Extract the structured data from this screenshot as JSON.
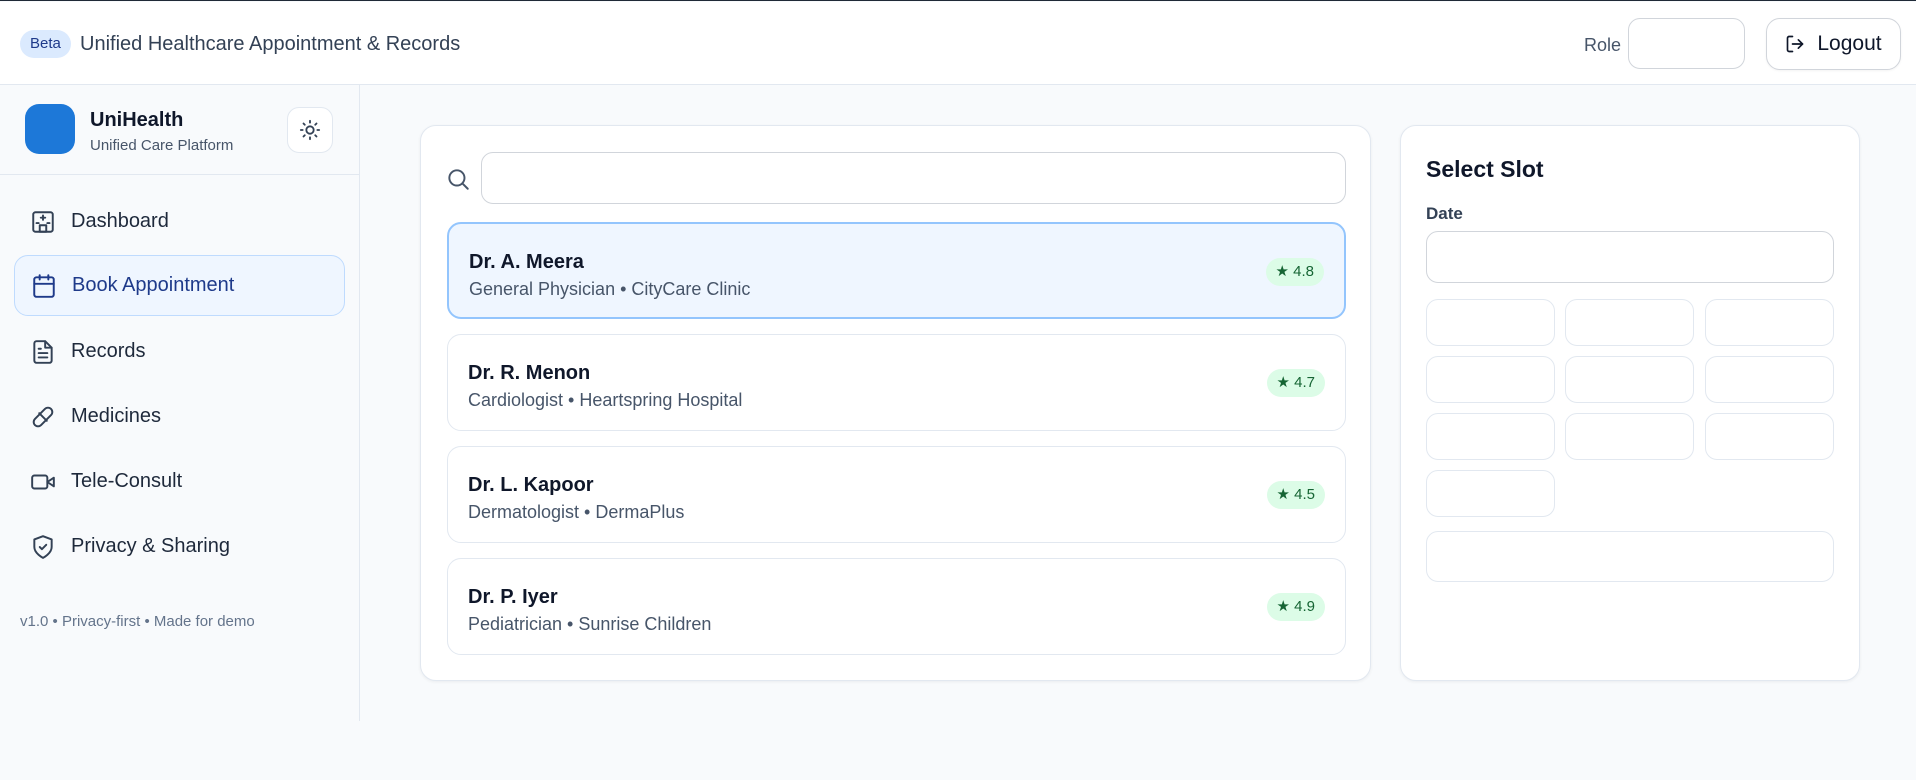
{
  "header": {
    "badge": "Beta",
    "title": "Unified Healthcare Appointment & Records",
    "role_label": "Role",
    "role_value": "",
    "logout_label": "Logout"
  },
  "sidebar": {
    "brand_name": "UniHealth",
    "brand_subtitle": "Unified Care Platform",
    "items": [
      {
        "label": "Dashboard",
        "icon": "hospital-icon"
      },
      {
        "label": "Book Appointment",
        "icon": "calendar-icon"
      },
      {
        "label": "Records",
        "icon": "document-icon"
      },
      {
        "label": "Medicines",
        "icon": "pill-icon"
      },
      {
        "label": "Tele-Consult",
        "icon": "video-icon"
      },
      {
        "label": "Privacy & Sharing",
        "icon": "shield-check-icon"
      }
    ],
    "active_item": "Book Appointment",
    "footer": "v1.0 • Privacy-first • Made for demo"
  },
  "search": {
    "value": "",
    "placeholder": ""
  },
  "doctors": [
    {
      "name": "Dr. A. Meera",
      "meta": "General Physician • CityCare Clinic",
      "rating": "★ 4.8",
      "selected": true
    },
    {
      "name": "Dr. R. Menon",
      "meta": "Cardiologist • Heartspring Hospital",
      "rating": "★ 4.7",
      "selected": false
    },
    {
      "name": "Dr. L. Kapoor",
      "meta": "Dermatologist • DermaPlus",
      "rating": "★ 4.5",
      "selected": false
    },
    {
      "name": "Dr. P. Iyer",
      "meta": "Pediatrician • Sunrise Children",
      "rating": "★ 4.9",
      "selected": false
    }
  ],
  "slot_panel": {
    "title": "Select Slot",
    "date_label": "Date",
    "date_value": "",
    "slots": [
      "",
      "",
      "",
      "",
      "",
      "",
      "",
      "",
      "",
      ""
    ],
    "confirm_label": ""
  },
  "colors": {
    "accent": "#1d78d8",
    "active_bg": "#eff6ff",
    "rating_bg": "#dcfce7",
    "rating_text": "#166534"
  }
}
